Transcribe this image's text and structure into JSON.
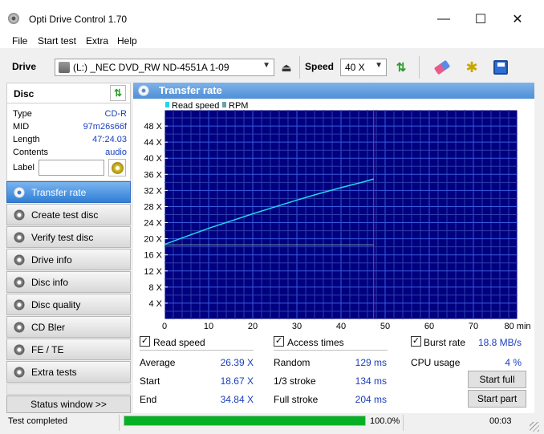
{
  "window": {
    "title": "Opti Drive Control 1.70",
    "minimize": "—",
    "maximize": "☐",
    "close": "✕"
  },
  "menu": [
    "File",
    "Start test",
    "Extra",
    "Help"
  ],
  "toolbar": {
    "drive_label": "Drive",
    "drive_value": "(L:)  _NEC DVD_RW ND-4551A 1-09",
    "speed_label": "Speed",
    "speed_value": "40 X"
  },
  "disc": {
    "header": "Disc",
    "rows": [
      {
        "label": "Type",
        "value": "CD-R"
      },
      {
        "label": "MID",
        "value": "97m26s66f"
      },
      {
        "label": "Length",
        "value": "47:24.03"
      },
      {
        "label": "Contents",
        "value": "audio"
      }
    ],
    "label_field": "Label",
    "label_value": ""
  },
  "nav": [
    {
      "label": "Transfer rate",
      "active": true
    },
    {
      "label": "Create test disc"
    },
    {
      "label": "Verify test disc"
    },
    {
      "label": "Drive info"
    },
    {
      "label": "Disc info"
    },
    {
      "label": "Disc quality"
    },
    {
      "label": "CD Bler"
    },
    {
      "label": "FE / TE"
    },
    {
      "label": "Extra tests"
    }
  ],
  "status_window_button": "Status window >>",
  "panel": {
    "title": "Transfer rate"
  },
  "chart_data": {
    "type": "line",
    "legend": [
      "Read speed",
      "RPM"
    ],
    "x_unit": "min",
    "xlim": [
      0,
      80
    ],
    "ylim": [
      0,
      52
    ],
    "x_ticks": [
      0,
      10,
      20,
      30,
      40,
      50,
      60,
      70,
      80
    ],
    "y_ticks": [
      4,
      8,
      12,
      16,
      20,
      24,
      28,
      32,
      36,
      40,
      44,
      48
    ],
    "y_tick_suffix": " X",
    "end_marker_x": 47.4,
    "grid": true,
    "series": [
      {
        "name": "Read speed",
        "color": "#22d8e8",
        "x": [
          0,
          5,
          10,
          15,
          20,
          25,
          30,
          35,
          40,
          45,
          47.4
        ],
        "y": [
          18.6,
          20.6,
          22.6,
          24.4,
          26.2,
          27.9,
          29.6,
          31.2,
          32.7,
          34.1,
          34.84
        ]
      },
      {
        "name": "RPM",
        "color": "#6f9ea8",
        "x": [
          0,
          47.4
        ],
        "y": [
          18.5,
          18.5
        ]
      }
    ]
  },
  "stats": {
    "read_speed": {
      "label": "Read speed",
      "checked": true,
      "rows": [
        {
          "label": "Average",
          "value": "26.39 X"
        },
        {
          "label": "Start",
          "value": "18.67 X"
        },
        {
          "label": "End",
          "value": "34.84 X"
        }
      ]
    },
    "access_times": {
      "label": "Access times",
      "checked": true,
      "rows": [
        {
          "label": "Random",
          "value": "129 ms"
        },
        {
          "label": "1/3 stroke",
          "value": "134 ms"
        },
        {
          "label": "Full stroke",
          "value": "204 ms"
        }
      ]
    },
    "burst": {
      "label": "Burst rate",
      "checked": true,
      "value": "18.8 MB/s"
    },
    "cpu": {
      "label": "CPU usage",
      "value": "4 %"
    },
    "start_full": "Start full",
    "start_part": "Start part"
  },
  "statusbar": {
    "text": "Test completed",
    "progress": 1.0,
    "progress_text": "100.0%",
    "elapsed": "00:03"
  }
}
